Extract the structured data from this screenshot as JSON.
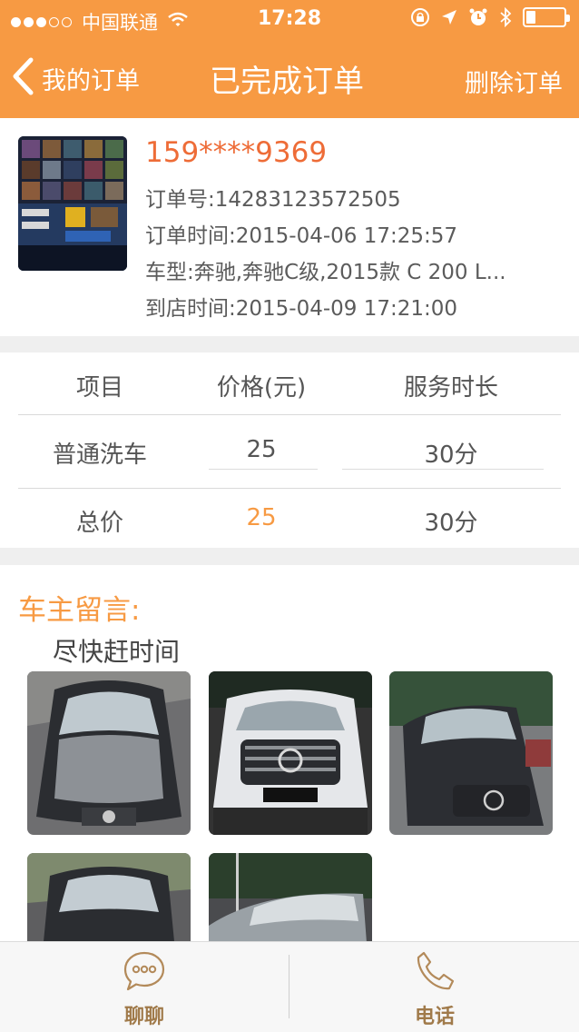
{
  "status_bar": {
    "carrier": "中国联通",
    "time": "17:28",
    "battery_level": 0.25
  },
  "nav": {
    "back_label": "我的订单",
    "title": "已完成订单",
    "action_label": "删除订单"
  },
  "order": {
    "phone": "159****9369",
    "order_no": "订单号:14283123572505",
    "order_time": "订单时间:2015-04-06 17:25:57",
    "car_model": "车型:奔驰,奔驰C级,2015款 C 200 L...",
    "arrival_time": "到店时间:2015-04-09 17:21:00"
  },
  "table": {
    "headers": [
      "项目",
      "价格(元)",
      "服务时长"
    ],
    "rows": [
      {
        "item": "普通洗车",
        "price": "25",
        "duration": "30分"
      }
    ],
    "total": {
      "label": "总价",
      "price": "25",
      "duration": "30分"
    }
  },
  "message": {
    "title": "车主留言:",
    "text": "尽快赶时间",
    "photo_count": 5
  },
  "tabbar": {
    "chat_label": "聊聊",
    "phone_label": "电话"
  },
  "colors": {
    "brand_orange": "#f79a43",
    "phone_red_orange": "#ee6c37",
    "tab_label_brown": "#a07a4a"
  }
}
